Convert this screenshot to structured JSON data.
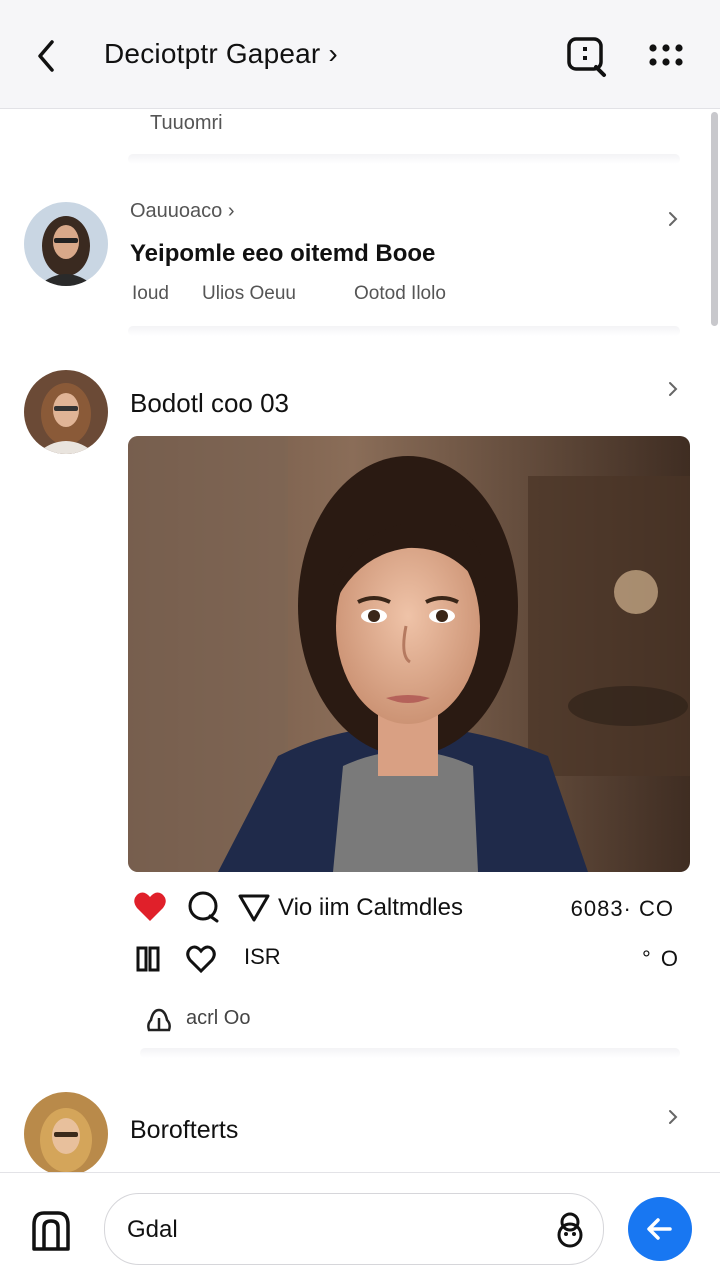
{
  "header": {
    "title": "Deciotptr Gapear ›"
  },
  "previous_item": {
    "label": "Tuuomri"
  },
  "item": {
    "subtitle": "Oauuoaco ›",
    "title": "Yeipomle eeo oitemd Booe",
    "meta_1": "Ioud",
    "meta_2": "Ulios Oeuu",
    "meta_3": "Ootod Ilolo"
  },
  "post": {
    "author": "Bodotl coo 03",
    "action_label": "Vio iim Caltmdles",
    "action_count": "6083· CO",
    "secondary_label": "ISR",
    "secondary_count": "° O",
    "tertiary_label": "acrl Oo"
  },
  "next_item": {
    "author": "Borofterts"
  },
  "composer": {
    "value": "Gdal"
  },
  "colors": {
    "accent": "#1877f2",
    "like": "#e0202a",
    "header_bg": "#f6f6f8"
  },
  "icons": [
    "back-arrow-icon",
    "search-icon",
    "more-icon",
    "chevron-right-icon",
    "heart-icon",
    "comment-icon",
    "share-icon",
    "bag-icon",
    "face-icon",
    "send-arrow-icon"
  ]
}
